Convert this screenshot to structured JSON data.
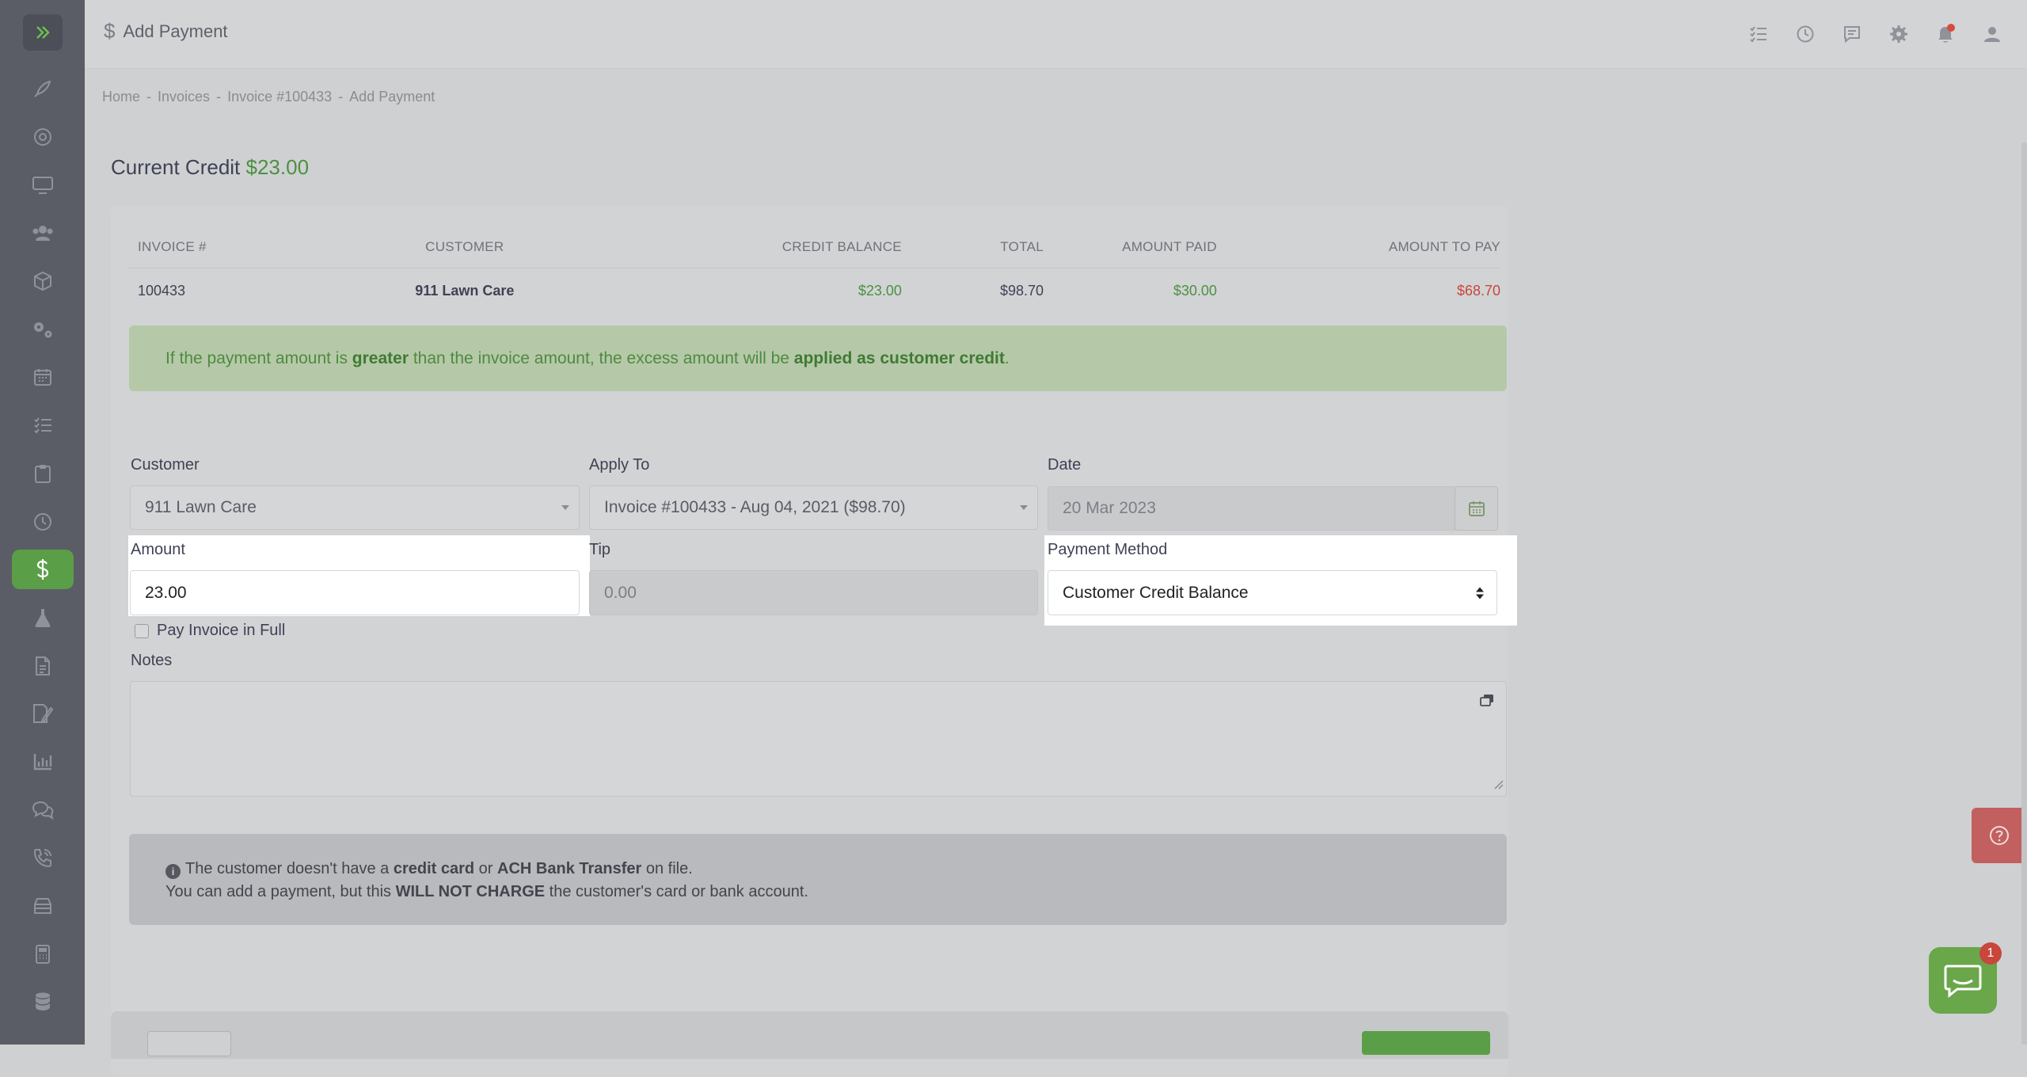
{
  "header": {
    "title": "Add Payment",
    "icons": [
      "checklist-icon",
      "clock-icon",
      "chat-icon",
      "gear-icon",
      "bell-icon",
      "user-icon"
    ],
    "accent_color": "#5b9e48",
    "notification_color": "#d94a3d"
  },
  "sidebar": {
    "items": [
      "rocket-icon",
      "lifebuoy-icon",
      "monitor-icon",
      "users-icon",
      "box-icon",
      "gears-icon",
      "calendar-icon",
      "list-icon",
      "clipboard-icon",
      "clock-icon",
      "dollar-icon",
      "flask-icon",
      "document-icon",
      "signature-icon",
      "chart-icon",
      "chat-icon",
      "phone-icon",
      "storage-icon",
      "calculator-icon",
      "database-icon"
    ],
    "active": "dollar-icon"
  },
  "breadcrumb": {
    "items": [
      "Home",
      "Invoices",
      "Invoice #100433",
      "Add Payment"
    ],
    "separator": "-"
  },
  "credit": {
    "label": "Current Credit",
    "value": "$23.00"
  },
  "invoice_table": {
    "headers": [
      "INVOICE #",
      "CUSTOMER",
      "CREDIT BALANCE",
      "TOTAL",
      "AMOUNT PAID",
      "AMOUNT TO PAY"
    ],
    "row": {
      "invoice": "100433",
      "customer": "911 Lawn Care",
      "credit_balance": "$23.00",
      "total": "$98.70",
      "amount_paid": "$30.00",
      "amount_to_pay": "$68.70"
    }
  },
  "alert_success": {
    "p1": "If the payment amount is ",
    "b1": "greater",
    "p2": " than the invoice amount, the excess amount will be ",
    "b2": "applied as customer credit",
    "p3": "."
  },
  "form": {
    "customer": {
      "label": "Customer",
      "value": "911 Lawn Care"
    },
    "apply_to": {
      "label": "Apply To",
      "value": "Invoice #100433 - Aug 04, 2021 ($98.70)"
    },
    "date": {
      "label": "Date",
      "value": "20 Mar 2023"
    },
    "amount": {
      "label": "Amount",
      "value": "23.00"
    },
    "tip": {
      "label": "Tip",
      "placeholder": "0.00"
    },
    "payment_method": {
      "label": "Payment Method",
      "value": "Customer Credit Balance"
    },
    "pay_in_full": {
      "label": "Pay Invoice in Full"
    },
    "notes": {
      "label": "Notes"
    }
  },
  "alert_info": {
    "l1_a": "The customer doesn't have a ",
    "l1_b": "credit card",
    "l1_c": " or ",
    "l1_d": "ACH Bank Transfer",
    "l1_e": " on file.",
    "l2_a": "You can add a payment, but this ",
    "l2_b": "WILL NOT CHARGE",
    "l2_c": " the customer's card or bank account."
  },
  "chat": {
    "badge": "1"
  }
}
